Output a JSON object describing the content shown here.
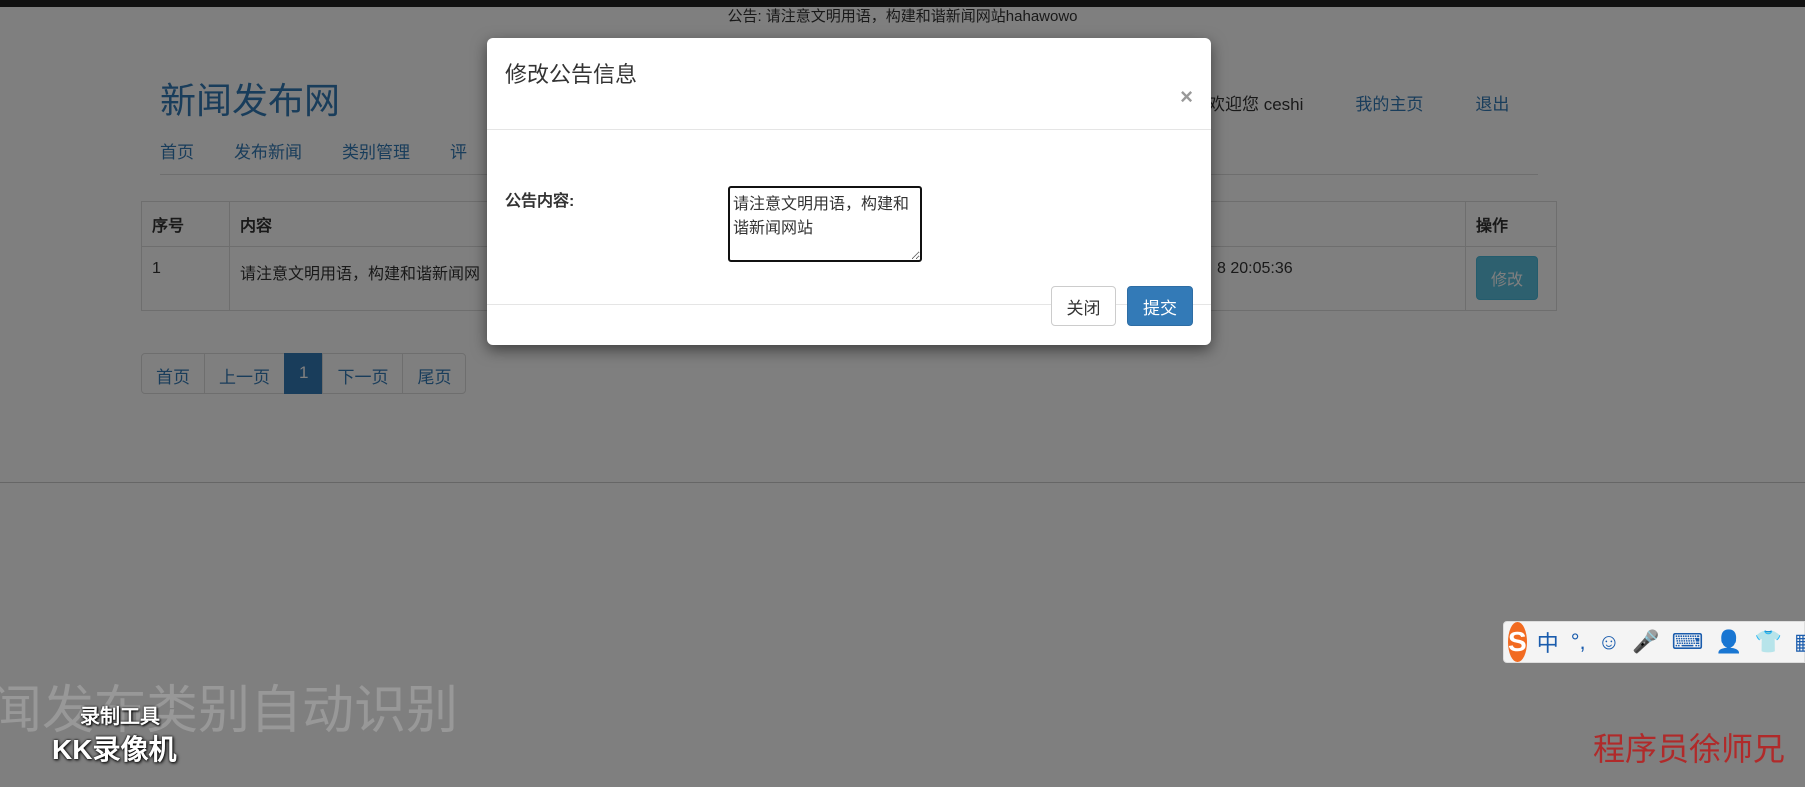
{
  "notice_line": "公告: 请注意文明用语，构建和谐新闻网站hahawowo",
  "site": {
    "title": "新闻发布网",
    "nav": [
      "首页",
      "发布新闻",
      "类别管理",
      "评"
    ],
    "welcome": "欢迎您 ceshi",
    "links": {
      "home": "我的主页",
      "logout": "退出"
    }
  },
  "table": {
    "headers": {
      "index": "序号",
      "content": "内容",
      "action": "操作"
    },
    "rows": [
      {
        "index": "1",
        "content": "请注意文明用语，构建和谐新闻网",
        "time": "8 20:05:36",
        "edit": "修改"
      }
    ]
  },
  "pager": {
    "first": "首页",
    "prev": "上一页",
    "current": "1",
    "next": "下一页",
    "last": "尾页"
  },
  "modal": {
    "title": "修改公告信息",
    "close_icon": "×",
    "label": "公告内容:",
    "textarea_value": "请注意文明用语，构建和谐新闻网站",
    "btn_close": "关闭",
    "btn_submit": "提交"
  },
  "ime": {
    "logo": "S",
    "items": [
      "中",
      "°,",
      "☺",
      "🎤",
      "⌨",
      "👤",
      "👕",
      "▦"
    ]
  },
  "overlay": {
    "watermark": "闻发布类别自动识别",
    "rec_tool": "录制工具",
    "rec_brand": "KK录像机",
    "author": "程序员徐师兄"
  },
  "colors": {
    "primary": "#337ab7",
    "info": "#5bc0de",
    "ime_orange": "#f26b21",
    "author_red": "#b02a2a"
  }
}
